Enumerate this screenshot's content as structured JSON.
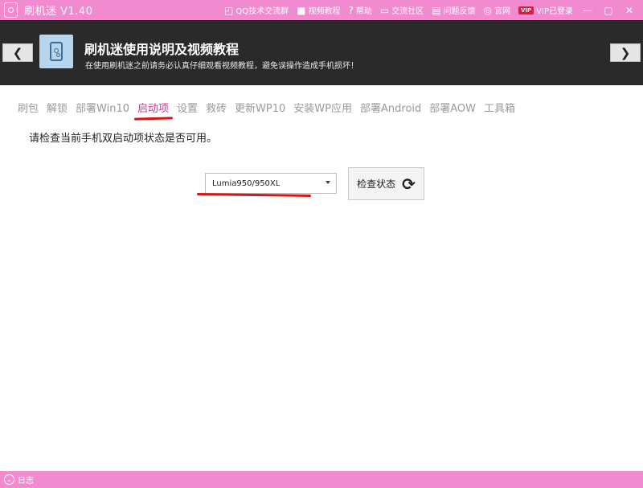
{
  "window": {
    "title": "刷机迷 V1.40",
    "links": [
      {
        "label": "QQ技术交流群",
        "icon": "qq-icon"
      },
      {
        "label": "视频教程",
        "icon": "video-icon"
      },
      {
        "label": "帮助",
        "icon": "question-icon"
      },
      {
        "label": "交流社区",
        "icon": "chat-icon"
      },
      {
        "label": "问题反馈",
        "icon": "feedback-icon"
      },
      {
        "label": "官网",
        "icon": "globe-icon"
      },
      {
        "label": "VIP已登录",
        "icon": "vip-icon",
        "badge": "VIP"
      }
    ],
    "controls": {
      "minimize": "—",
      "maximize": "▢",
      "close": "✕"
    }
  },
  "header": {
    "title": "刷机迷使用说明及视频教程",
    "subtitle": "在使用刷机迷之前请务必认真仔细观看视频教程，避免误操作造成手机损坏！",
    "prev_glyph": "❮",
    "next_glyph": "❯"
  },
  "tabs": [
    {
      "label": "刷包"
    },
    {
      "label": "解锁"
    },
    {
      "label": "部署Win10"
    },
    {
      "label": "启动项",
      "active": true
    },
    {
      "label": "设置"
    },
    {
      "label": "救砖"
    },
    {
      "label": "更新WP10"
    },
    {
      "label": "安装WP应用"
    },
    {
      "label": "部署Android"
    },
    {
      "label": "部署AOW"
    },
    {
      "label": "工具箱"
    }
  ],
  "main": {
    "instruction": "请检查当前手机双启动项状态是否可用。",
    "device_select": {
      "value": "Lumia950/950XL"
    },
    "check_button": {
      "label": "检查状态",
      "icon": "refresh-icon",
      "glyph": "⟳"
    }
  },
  "footer": {
    "log_label": "日志",
    "log_glyph": "⌄"
  },
  "colors": {
    "accent": "#f28ad0",
    "header_bg": "#2a2a2a",
    "active_tab": "#e3299d",
    "annotation_red": "#d41616"
  }
}
